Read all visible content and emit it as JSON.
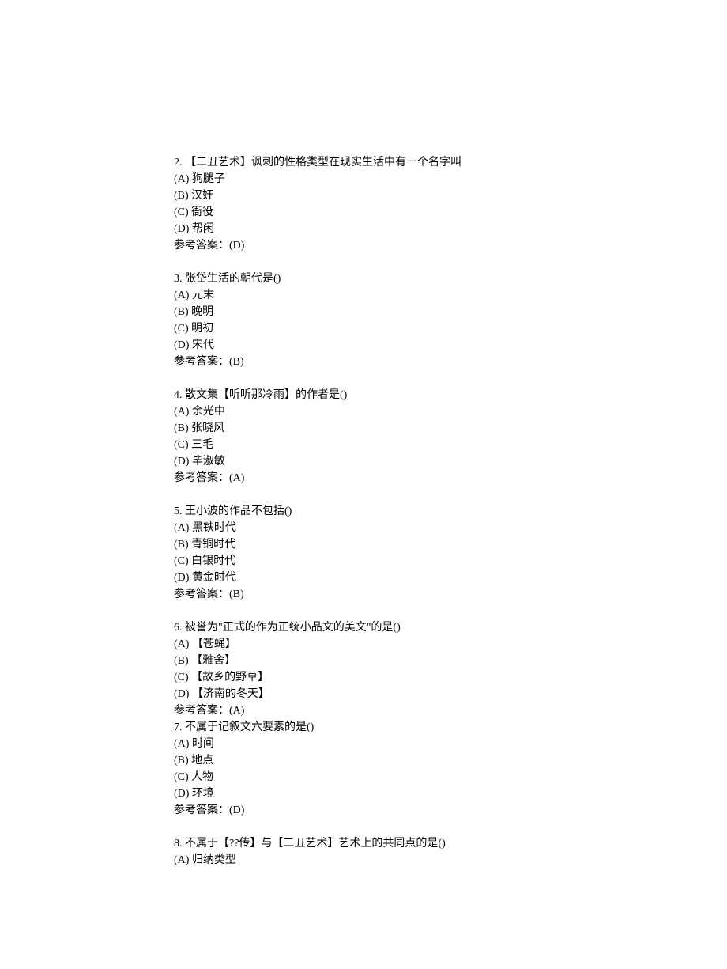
{
  "questions": [
    {
      "number": "2.",
      "stem": "【二丑艺术】讽刺的性格类型在现实生活中有一个名字叫",
      "options": [
        {
          "label": "(A)",
          "text": "狗腿子"
        },
        {
          "label": "(B)",
          "text": "汉奸"
        },
        {
          "label": "(C)",
          "text": "衙役"
        },
        {
          "label": "(D)",
          "text": "帮闲"
        }
      ],
      "answer_prefix": "参考答案：",
      "answer": "(D)"
    },
    {
      "number": "3.",
      "stem": "张岱生活的朝代是()",
      "options": [
        {
          "label": "(A)",
          "text": "元末"
        },
        {
          "label": "(B)",
          "text": "晚明"
        },
        {
          "label": "(C)",
          "text": "明初"
        },
        {
          "label": "(D)",
          "text": "宋代"
        }
      ],
      "answer_prefix": "参考答案：",
      "answer": "(B)"
    },
    {
      "number": "4.",
      "stem": "散文集【听听那冷雨】的作者是()",
      "options": [
        {
          "label": "(A)",
          "text": "余光中"
        },
        {
          "label": "(B)",
          "text": "张晓风"
        },
        {
          "label": "(C)",
          "text": "三毛"
        },
        {
          "label": "(D)",
          "text": "毕淑敏"
        }
      ],
      "answer_prefix": "参考答案：",
      "answer": "(A)"
    },
    {
      "number": "5.",
      "stem": "王小波的作品不包括()",
      "options": [
        {
          "label": "(A)",
          "text": "黑铁时代"
        },
        {
          "label": "(B)",
          "text": "青铜时代"
        },
        {
          "label": "(C)",
          "text": "白银时代"
        },
        {
          "label": "(D)",
          "text": "黄金时代"
        }
      ],
      "answer_prefix": "参考答案：",
      "answer": "(B)"
    },
    {
      "number": "6.",
      "stem": "被誉为\"正式的作为正统小品文的美文\"的是()",
      "options": [
        {
          "label": "(A)",
          "text": "【苍蝇】"
        },
        {
          "label": "(B)",
          "text": "【雅舍】"
        },
        {
          "label": "(C)",
          "text": "【故乡的野草】"
        },
        {
          "label": "(D)",
          "text": "【济南的冬天】"
        }
      ],
      "answer_prefix": "参考答案：",
      "answer": "(A)"
    },
    {
      "number": "7.",
      "stem": "不属于记叙文六要素的是()",
      "options": [
        {
          "label": "(A)",
          "text": "时间"
        },
        {
          "label": "(B)",
          "text": "地点"
        },
        {
          "label": "(C)",
          "text": "人物"
        },
        {
          "label": "(D)",
          "text": "环境"
        }
      ],
      "answer_prefix": "参考答案：",
      "answer": "(D)"
    },
    {
      "number": "8.",
      "stem": "不属于【??传】与【二丑艺术】艺术上的共同点的是()",
      "options": [
        {
          "label": "(A)",
          "text": "归纳类型"
        }
      ],
      "answer_prefix": "",
      "answer": ""
    }
  ]
}
